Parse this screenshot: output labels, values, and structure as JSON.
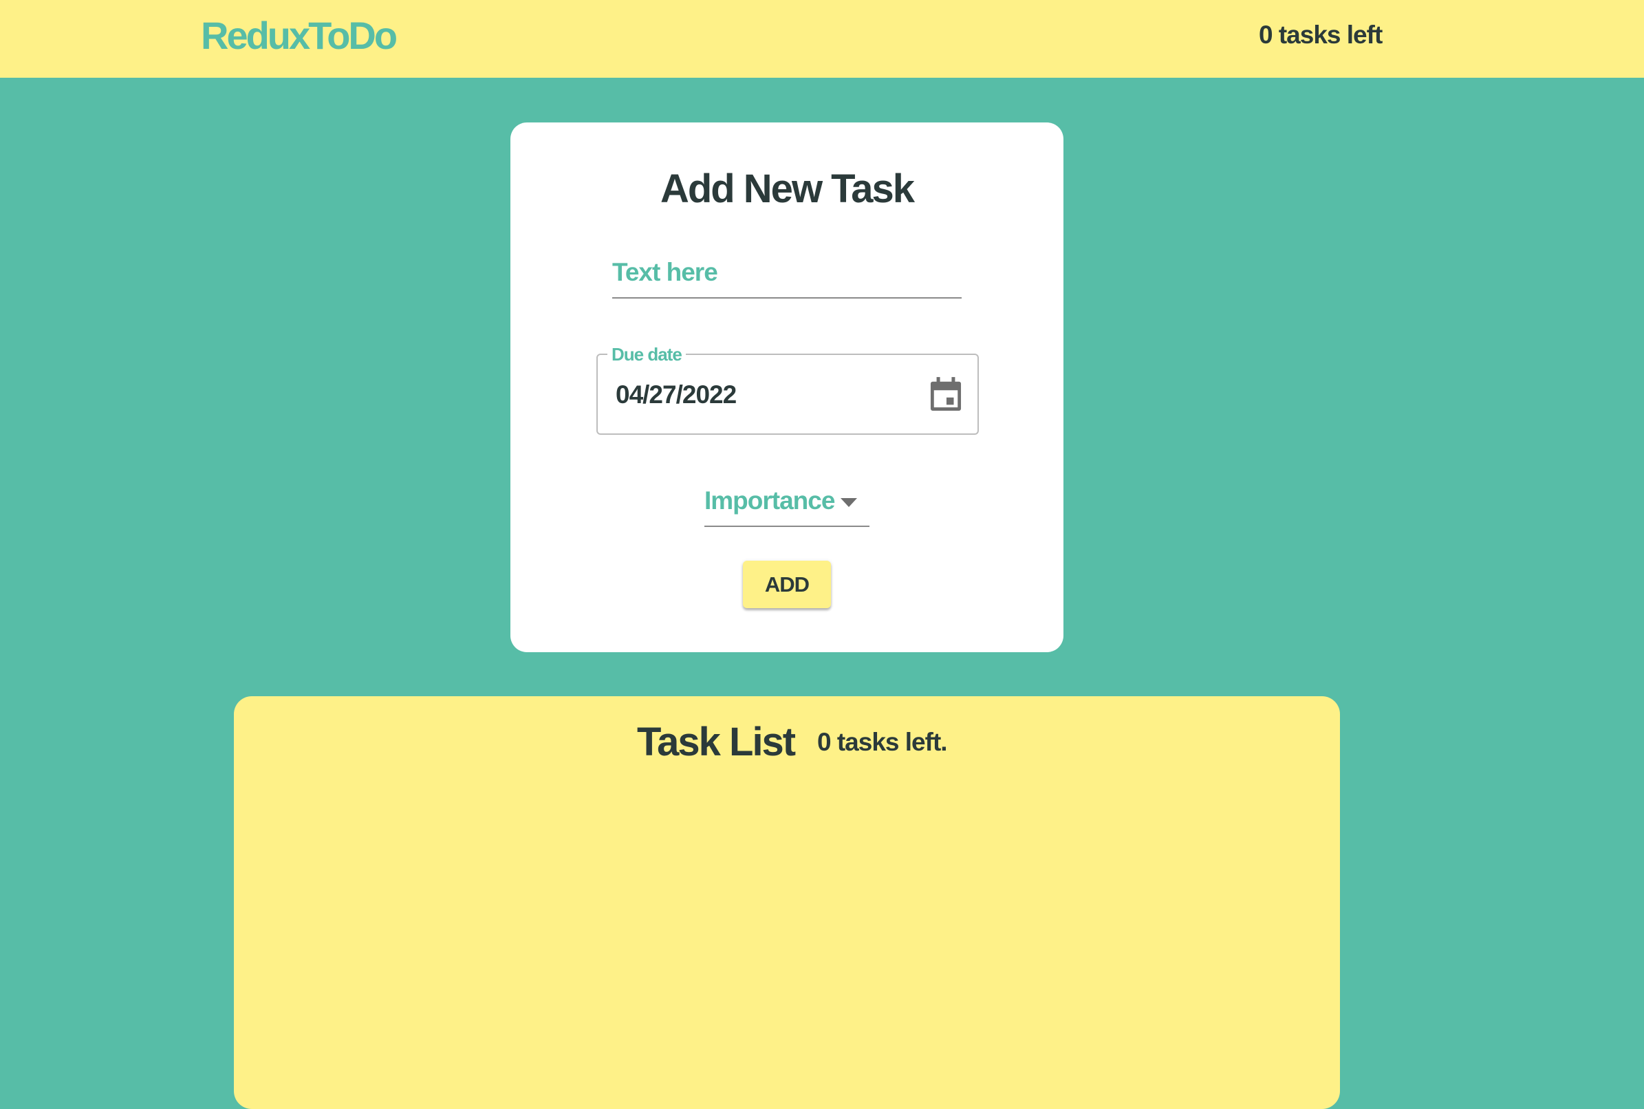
{
  "navbar": {
    "brand": "ReduxToDo",
    "tasks_left": "0 tasks left"
  },
  "form": {
    "title": "Add New Task",
    "text_placeholder": "Text here",
    "due_date_label": "Due date",
    "due_date_value": "04/27/2022",
    "importance_label": "Importance",
    "add_label": "ADD"
  },
  "task_list": {
    "title": "Task List",
    "count": "0 tasks left."
  },
  "colors": {
    "background": "#57bda7",
    "accent_yellow": "#fef188",
    "text_dark": "#2b3a3a",
    "card": "#ffffff"
  },
  "icons": {
    "calendar": "calendar-icon",
    "dropdown": "chevron-down-icon"
  }
}
